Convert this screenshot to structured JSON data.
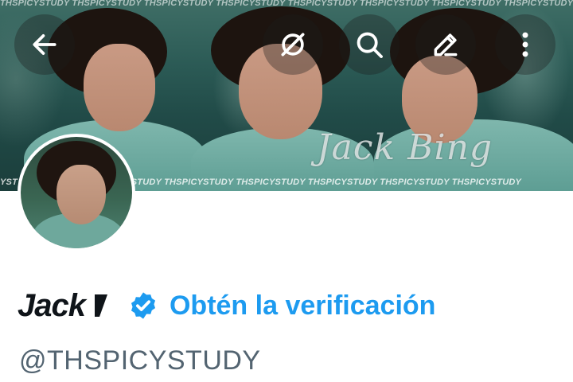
{
  "banner": {
    "watermark": "THSPICYSTUDY THSPICYSTUDY THSPICYSTUDY THSPICYSTUDY THSPICYSTUDY THSPICYSTUDY THSPICYSTUDY THSPICYSTUDY",
    "watermark_bottom": "YST THSPICYSTUDY THSPICYSTUDY THSPICYSTUDY THSPICYSTUDY THSPICYSTUDY THSPICYSTUDY THSPICYSTUDY",
    "signature": "Jack Bing"
  },
  "toolbar": {
    "back_icon": "arrow-left-icon",
    "grok_icon": "grok-icon",
    "search_icon": "search-icon",
    "edit_icon": "pencil-icon",
    "more_icon": "more-vertical-icon"
  },
  "profile": {
    "display_name": "Jack",
    "verified_icon": "verified-badge-icon",
    "get_verified_label": "Obtén la verificación",
    "handle": "@THSPICYSTUDY"
  },
  "colors": {
    "accent": "#1d9bf0",
    "text_primary": "#0f1419",
    "text_secondary": "#536471"
  }
}
